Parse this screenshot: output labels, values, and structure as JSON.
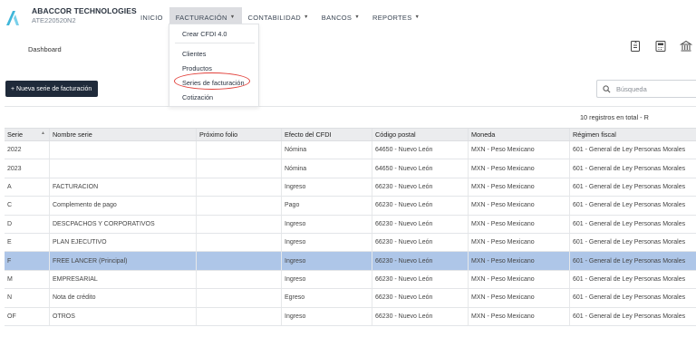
{
  "header": {
    "company": "ABACCOR TECHNOLOGIES",
    "rfc": "ATE220520N2",
    "nav": [
      {
        "label": "INICIO",
        "caret": false,
        "active": false
      },
      {
        "label": "FACTURACIÓN",
        "caret": true,
        "active": true
      },
      {
        "label": "CONTABILIDAD",
        "caret": true,
        "active": false
      },
      {
        "label": "BANCOS",
        "caret": true,
        "active": false
      },
      {
        "label": "REPORTES",
        "caret": true,
        "active": false
      }
    ]
  },
  "dropdown": {
    "items": [
      "Crear CFDI 4.0",
      "Clientes",
      "Productos",
      "Series de facturación",
      "Cotización"
    ],
    "highlighted": "Series de facturación"
  },
  "breadcrumb": "Dashboard",
  "toolbar_icons": [
    "document-icon",
    "calculator-icon",
    "bank-icon"
  ],
  "new_button_label": "+ Nueva serie de facturación",
  "search": {
    "placeholder": "Búsqueda"
  },
  "record_count": "10 registros en total - R",
  "table": {
    "columns": [
      "Serie",
      "Nombre serie",
      "Próximo folio",
      "Efecto del CFDI",
      "Código postal",
      "Moneda",
      "Régimen fiscal"
    ],
    "rows": [
      [
        "2022",
        "",
        "",
        "Nómina",
        "64650 - Nuevo León",
        "MXN - Peso Mexicano",
        "601 - General de Ley Personas Morales"
      ],
      [
        "2023",
        "",
        "",
        "Nómina",
        "64650 - Nuevo León",
        "MXN - Peso Mexicano",
        "601 - General de Ley Personas Morales"
      ],
      [
        "A",
        "FACTURACION",
        "",
        "Ingreso",
        "66230 - Nuevo León",
        "MXN - Peso Mexicano",
        "601 - General de Ley Personas Morales"
      ],
      [
        "C",
        "Complemento de pago",
        "",
        "Pago",
        "66230 - Nuevo León",
        "MXN - Peso Mexicano",
        "601 - General de Ley Personas Morales"
      ],
      [
        "D",
        "DESCPACHOS Y CORPORATIVOS",
        "",
        "Ingreso",
        "66230 - Nuevo León",
        "MXN - Peso Mexicano",
        "601 - General de Ley Personas Morales"
      ],
      [
        "E",
        "PLAN EJECUTIVO",
        "",
        "Ingreso",
        "66230 - Nuevo León",
        "MXN - Peso Mexicano",
        "601 - General de Ley Personas Morales"
      ],
      [
        "F",
        "FREE LANCER (Principal)",
        "",
        "Ingreso",
        "66230 - Nuevo León",
        "MXN - Peso Mexicano",
        "601 - General de Ley Personas Morales"
      ],
      [
        "M",
        "EMPRESARIAL",
        "",
        "Ingreso",
        "66230 - Nuevo León",
        "MXN - Peso Mexicano",
        "601 - General de Ley Personas Morales"
      ],
      [
        "N",
        "Nota de crédito",
        "",
        "Egreso",
        "66230 - Nuevo León",
        "MXN - Peso Mexicano",
        "601 - General de Ley Personas Morales"
      ],
      [
        "OF",
        "OTROS",
        "",
        "Ingreso",
        "66230 - Nuevo León",
        "MXN - Peso Mexicano",
        "601 - General de Ley Personas Morales"
      ]
    ],
    "selected_row": 6
  },
  "colors": {
    "primary_dark": "#1f2a3a",
    "selected_row": "#aec6e8",
    "annotation": "#e2403a",
    "logo": "#3fb6d9"
  }
}
